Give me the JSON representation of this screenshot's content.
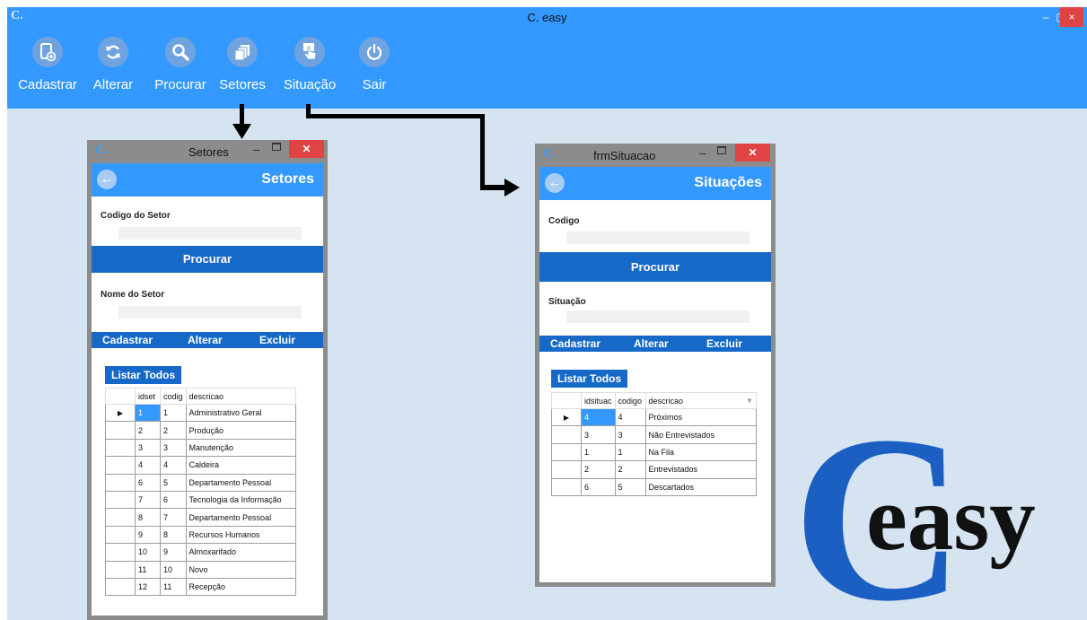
{
  "main": {
    "logo": "C.",
    "title": "C. easy",
    "controls": {
      "minimize": "–",
      "maximize": "▢",
      "close": "×"
    }
  },
  "toolbar": [
    {
      "id": "cadastrar",
      "label": "Cadastrar",
      "icon": "add-document-icon"
    },
    {
      "id": "alterar",
      "label": "Alterar",
      "icon": "refresh-icon"
    },
    {
      "id": "procurar",
      "label": "Procurar",
      "icon": "search-icon"
    },
    {
      "id": "setores",
      "label": "Setores",
      "icon": "copy-icon"
    },
    {
      "id": "situacao",
      "label": "Situação",
      "icon": "touch-icon"
    },
    {
      "id": "sair",
      "label": "Sair",
      "icon": "power-icon"
    }
  ],
  "setores": {
    "window_logo": "C.",
    "window_title": "Setores",
    "header_title": "Setores",
    "back_icon": "←",
    "field1_label": "Codigo do Setor",
    "search_button": "Procurar",
    "field2_label": "Nome do Setor",
    "actions": {
      "cadastrar": "Cadastrar",
      "alterar": "Alterar",
      "excluir": "Excluir"
    },
    "list_all_button": "Listar Todos",
    "grid": {
      "columns": [
        "idset",
        "codigo",
        "descricao"
      ],
      "column_display": [
        "idset",
        "codig",
        "descricao"
      ],
      "rows": [
        [
          "1",
          "1",
          "Administrativo Geral"
        ],
        [
          "2",
          "2",
          "Produção"
        ],
        [
          "3",
          "3",
          "Manutenção"
        ],
        [
          "4",
          "4",
          "Caldeira"
        ],
        [
          "6",
          "5",
          "Departamento Pessoal"
        ],
        [
          "7",
          "6",
          "Tecnologia da Informação"
        ],
        [
          "8",
          "7",
          "Departamento Pessoal"
        ],
        [
          "9",
          "8",
          "Recursos Humanos"
        ],
        [
          "10",
          "9",
          "Almoxarifado"
        ],
        [
          "11",
          "10",
          "Novo"
        ],
        [
          "12",
          "11",
          "Recepção"
        ]
      ],
      "selected_row": 0
    }
  },
  "situacao": {
    "window_logo": "C.",
    "window_title": "frmSituacao",
    "header_title": "Situações",
    "back_icon": "←",
    "field1_label": "Codigo",
    "search_button": "Procurar",
    "field2_label": "Situação",
    "actions": {
      "cadastrar": "Cadastrar",
      "alterar": "Alterar",
      "excluir": "Excluir"
    },
    "list_all_button": "Listar Todos",
    "grid": {
      "columns": [
        "idsituacao",
        "codigo",
        "descricao"
      ],
      "column_display": [
        "idsituac",
        "codigo",
        "descricao"
      ],
      "rows": [
        [
          "4",
          "4",
          "Próximos"
        ],
        [
          "3",
          "3",
          "Não Entrevistados"
        ],
        [
          "1",
          "1",
          "Na Fila"
        ],
        [
          "2",
          "2",
          "Entrevistados"
        ],
        [
          "6",
          "5",
          "Descartados"
        ]
      ],
      "selected_row": 0
    }
  },
  "brand": {
    "big_letter": "C",
    "word": "easy"
  },
  "colors": {
    "accent": "#3399ff",
    "dark_accent": "#1769c8",
    "desktop": "#d6e4f2",
    "close_red": "#e04343"
  }
}
